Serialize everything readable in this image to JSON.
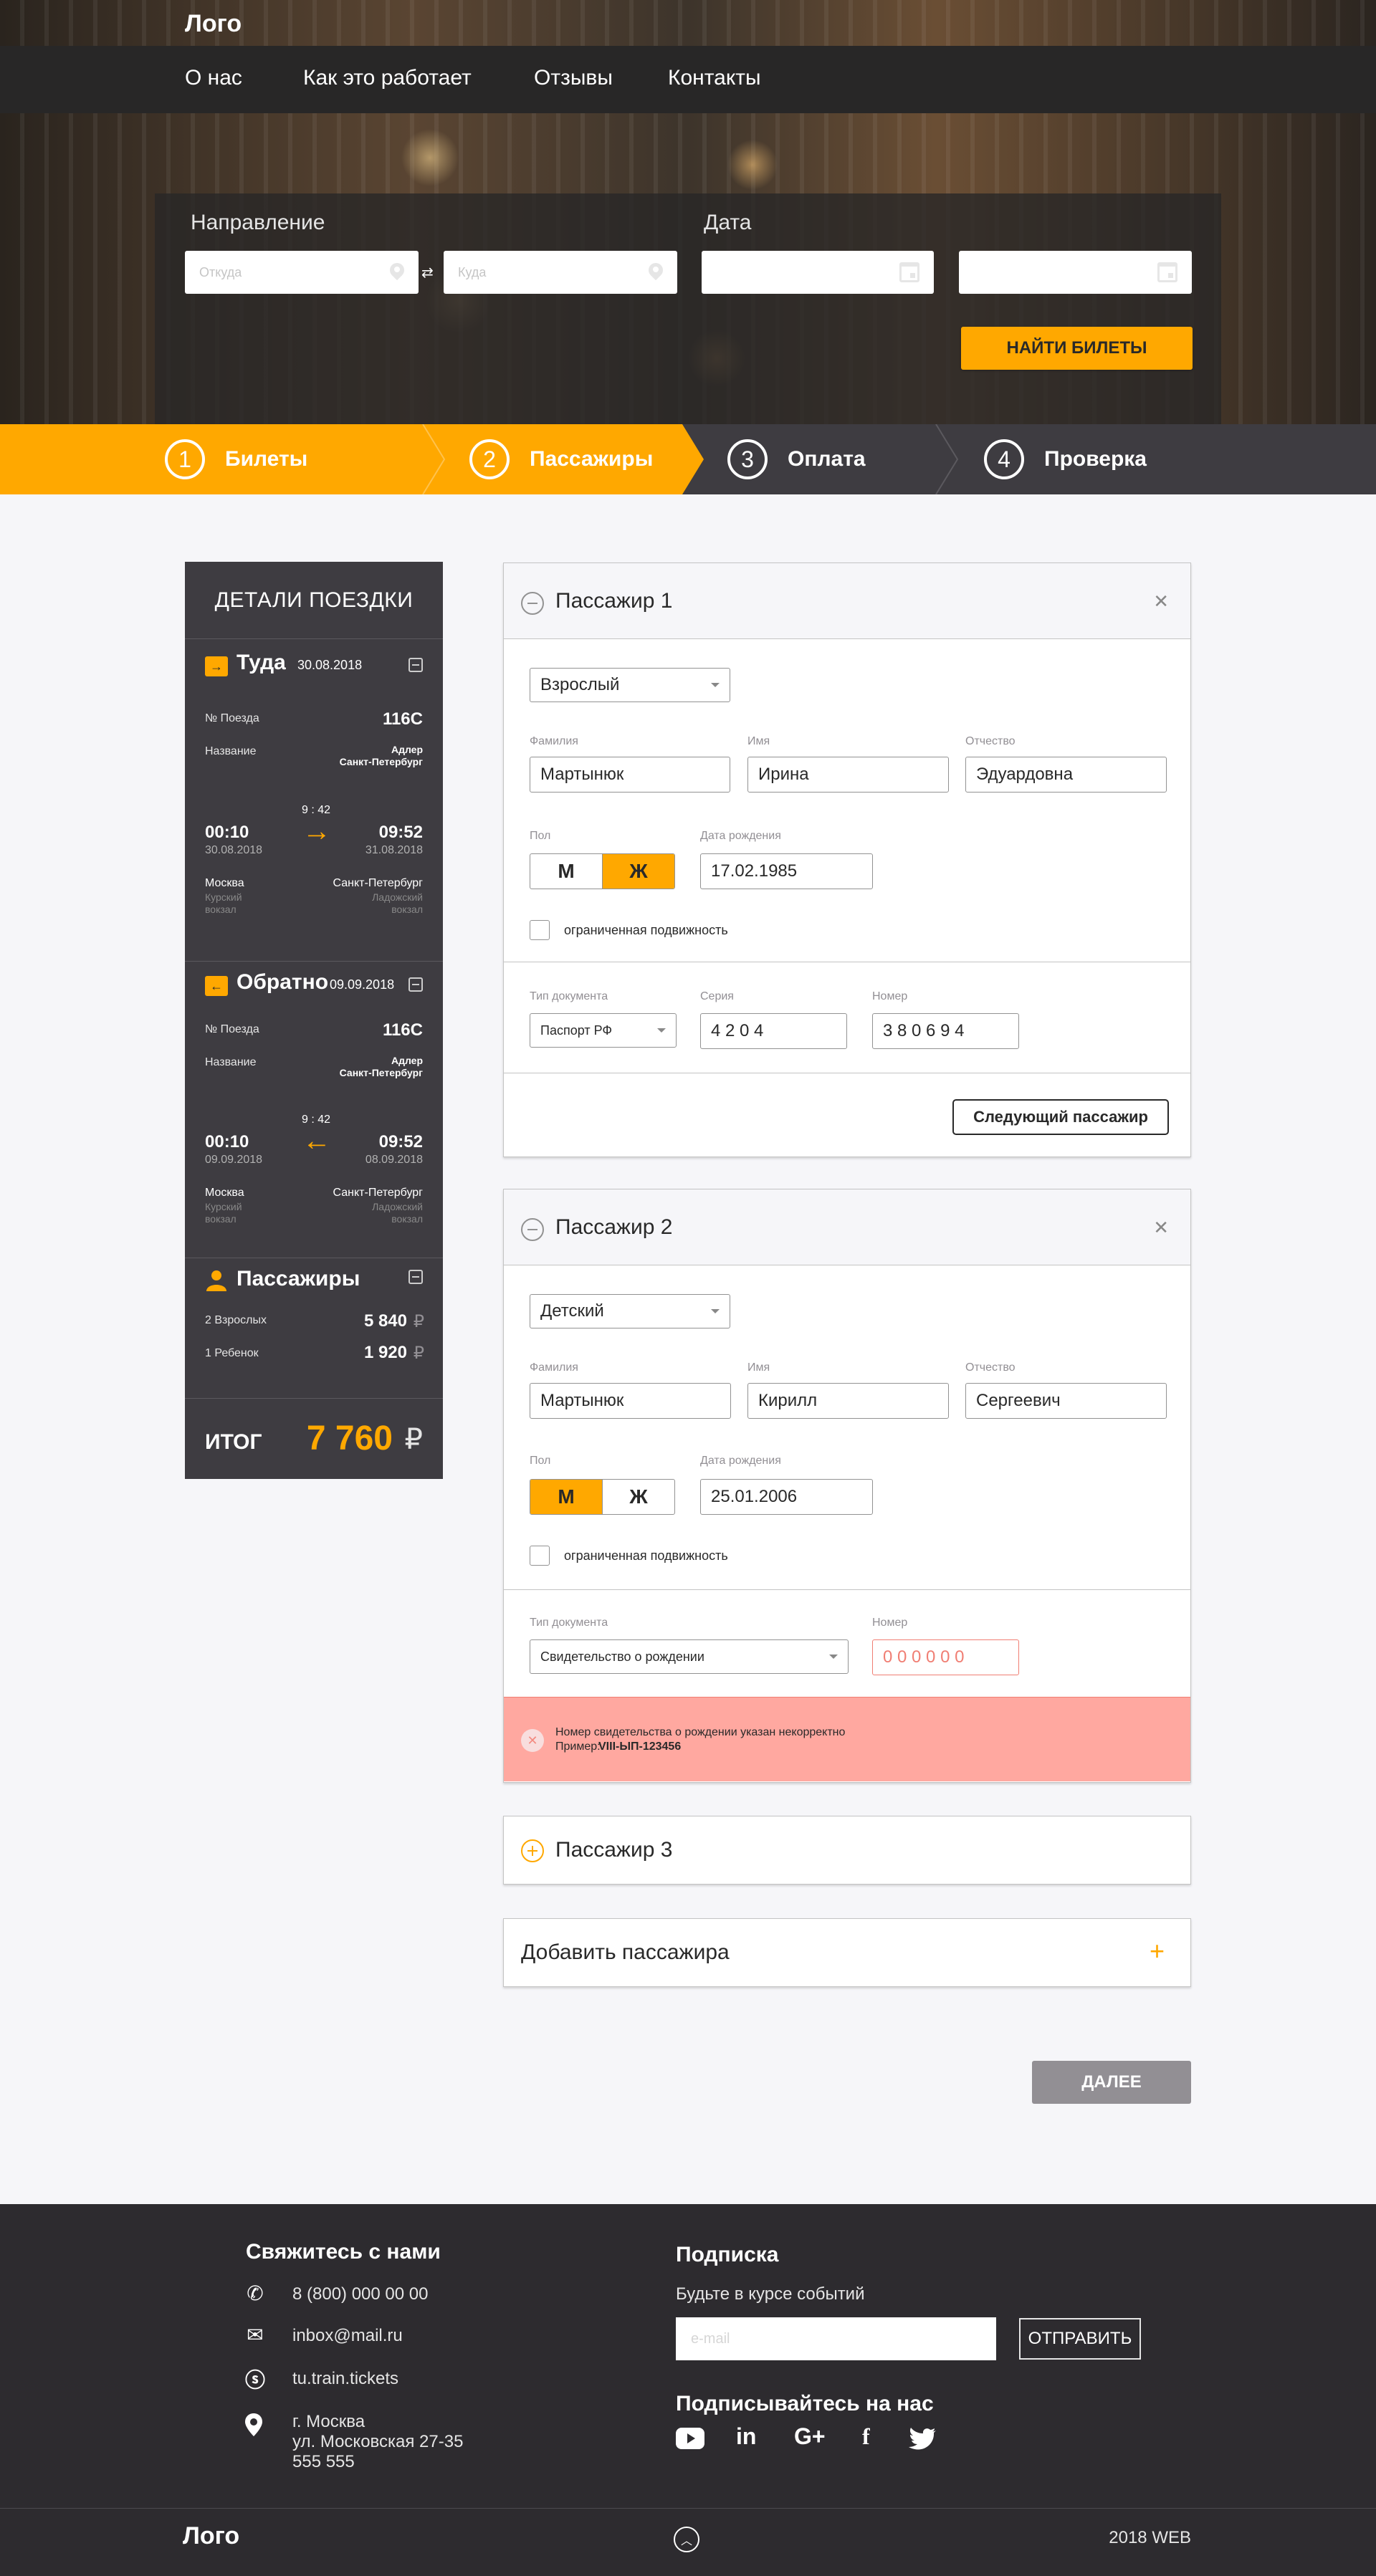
{
  "header": {
    "logo": "Лого",
    "nav": [
      "О нас",
      "Как это работает",
      "Отзывы",
      "Контакты"
    ]
  },
  "search": {
    "direction_label": "Направление",
    "date_label": "Дата",
    "from_placeholder": "Откуда",
    "to_placeholder": "Куда",
    "find_button": "НАЙТИ БИЛЕТЫ"
  },
  "steps": [
    {
      "num": "1",
      "label": "Билеты"
    },
    {
      "num": "2",
      "label": "Пассажиры"
    },
    {
      "num": "3",
      "label": "Оплата"
    },
    {
      "num": "4",
      "label": "Проверка"
    }
  ],
  "sidebar": {
    "title": "Детали поездки",
    "there": {
      "title": "Туда",
      "date": "30.08.2018",
      "train_label": "№ Поезда",
      "train": "116С",
      "name_label": "Название",
      "name_1": "Адлер",
      "name_2": "Санкт-Петербург",
      "dur": "9 : 42",
      "dep_time": "00:10",
      "dep_date": "30.08.2018",
      "arr_time": "09:52",
      "arr_date": "31.08.2018",
      "from_city": "Москва",
      "from_st_1": "Курский",
      "from_st_2": "вокзал",
      "to_city": "Санкт-Петербург",
      "to_st_1": "Ладожский",
      "to_st_2": "вокзал"
    },
    "back": {
      "title": "Обратно",
      "date": "09.09.2018",
      "train_label": "№ Поезда",
      "train": "116С",
      "name_label": "Название",
      "name_1": "Адлер",
      "name_2": "Санкт-Петербург",
      "dur": "9 : 42",
      "dep_time": "00:10",
      "dep_date": "09.09.2018",
      "arr_time": "09:52",
      "arr_date": "08.09.2018",
      "from_city": "Москва",
      "from_st_1": "Курский",
      "from_st_2": "вокзал",
      "to_city": "Санкт-Петербург",
      "to_st_1": "Ладожский",
      "to_st_2": "вокзал"
    },
    "passengers": {
      "title": "Пассажиры",
      "adults_label": "2 Взрослых",
      "adults_price": "5 840",
      "child_label": "1 Ребенок",
      "child_price": "1 920",
      "currency": "₽"
    },
    "total_label": "ИТОГ",
    "total": "7 760",
    "currency": "₽"
  },
  "labels": {
    "surname": "Фамилия",
    "name": "Имя",
    "patronymic": "Отчество",
    "sex": "Пол",
    "birth": "Дата рождения",
    "limited": "ограниченная подвижность",
    "doc_type": "Тип документа",
    "series": "Серия",
    "number": "Номер",
    "male": "М",
    "female": "Ж"
  },
  "p1": {
    "title": "Пассажир 1",
    "type": "Взрослый",
    "surname": "Мартынюк",
    "name": "Ирина",
    "patronymic": "Эдуардовна",
    "sex": "Ж",
    "birth": "17.02.1985",
    "doc_type": "Паспорт РФ",
    "series": "4 2 0 4",
    "number": "3 8 0 6 9 4",
    "next": "Следующий пассажир"
  },
  "p2": {
    "title": "Пассажир 2",
    "type": "Детский",
    "surname": "Мартынюк",
    "name": "Кирилл",
    "patronymic": "Сергеевич",
    "sex": "М",
    "birth": "25.01.2006",
    "doc_type": "Свидетельство о рождении",
    "number": "0 0 0 0 0 0",
    "error_1": "Номер свидетельства о рождении указан некорректно",
    "error_2_prefix": "Пример:",
    "error_2_example": "VIII-ЫП-123456"
  },
  "p3": {
    "title": "Пассажир 3"
  },
  "add_passenger": "Добавить пассажира",
  "next_button": "ДАЛЕЕ",
  "footer": {
    "contact_title": "Свяжитесь с нами",
    "phone": "8 (800) 000 00 00",
    "email": "inbox@mail.ru",
    "skype": "tu.train.tickets",
    "addr_1": "г. Москва",
    "addr_2": "ул. Московская 27-35",
    "addr_3": "555 555",
    "subscribe_title": "Подписка",
    "subscribe_text": "Будьте в курсе событий",
    "email_placeholder": "e-mail",
    "send": "ОТПРАВИТЬ",
    "follow_title": "Подписывайтесь на нас",
    "logo": "Лого",
    "year": "2018 WEB"
  },
  "colors": {
    "accent": "#ffa800",
    "dark": "#3e3c41",
    "error_bg": "#ffa8a0"
  }
}
